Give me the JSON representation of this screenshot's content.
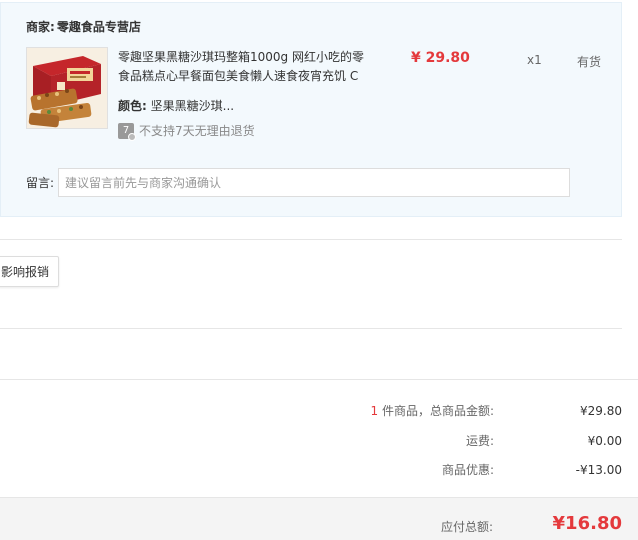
{
  "colors": {
    "accent": "#e4393c",
    "panel_bg": "#f3f9fd",
    "total_bar_bg": "#f4f4f4",
    "text_primary": "#333333",
    "text_muted": "#999999"
  },
  "shop": {
    "merchant_label": "商家:",
    "merchant_name": "零趣食品专营店"
  },
  "item": {
    "title": "零趣坚果黑糖沙琪玛整箱1000g 网红小吃的零食品糕点心早餐面包美食懒人速食夜宵充饥 C",
    "image_icon": "product-box-image",
    "price": "¥ 29.80",
    "quantity": "x1",
    "stock": "有货",
    "spec_label": "颜色:",
    "spec_value": "坚果黑糖沙琪...",
    "return_icon_text": "7",
    "return_note": "不支持7天无理由退货"
  },
  "remark": {
    "label": "留言:",
    "placeholder": "建议留言前先与商家沟通确认",
    "value": ""
  },
  "invoice": {
    "button_label": "影响报销"
  },
  "summary": {
    "count": "1",
    "count_suffix": " 件商品，总商品金额:",
    "subtotal": "¥29.80",
    "shipping_label": "运费:",
    "shipping": "¥0.00",
    "discount_label": "商品优惠:",
    "discount": "-¥13.00",
    "total_label": "应付总额:",
    "total": "¥16.80"
  }
}
